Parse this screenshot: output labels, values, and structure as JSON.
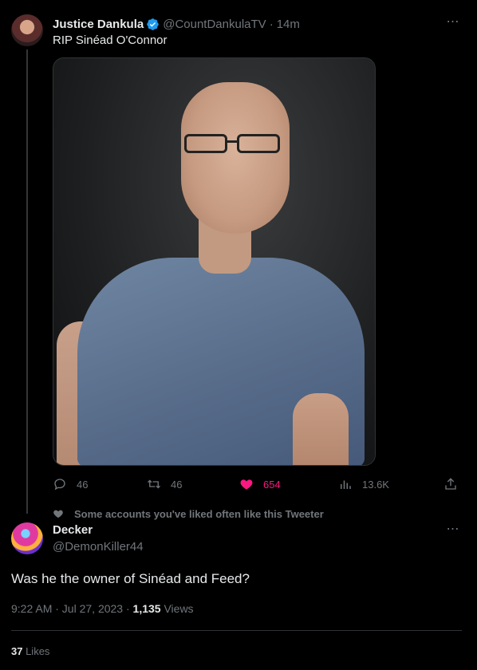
{
  "tweet": {
    "author_name": "Justice Dankula",
    "author_handle": "@CountDankulaTV",
    "separator": "·",
    "time_ago": "14m",
    "text": "RIP Sinéad O'Connor",
    "replies": "46",
    "retweets": "46",
    "likes": "654",
    "views": "13.6K",
    "media_icon": "photo",
    "verified_icon": "verified-badge-icon",
    "like_color": "#f91880",
    "accent_color": "#1d9bf0"
  },
  "social_context": "Some accounts you've liked often like this Tweeter",
  "reply": {
    "author_name": "Decker",
    "author_handle": "@DemonKiller44",
    "text": "Was he the owner of Sinéad and Feed?",
    "time": "9:22 AM · Jul 27, 2023 · ",
    "views_count": "1,135",
    "views_label": " Views",
    "likes_count": "37",
    "likes_label": " Likes"
  },
  "icons": {
    "more": "⋯"
  }
}
